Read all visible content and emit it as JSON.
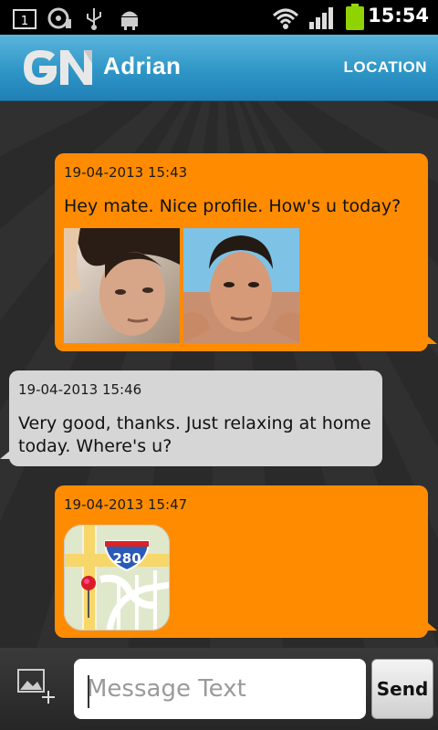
{
  "status_bar": {
    "notification_count": "1",
    "time": "15:54",
    "icons": [
      "notification-counter-icon",
      "sd-card-icon",
      "usb-icon",
      "android-debug-icon",
      "wifi-icon",
      "signal-icon",
      "battery-icon"
    ],
    "battery_color": "#8fd400"
  },
  "header": {
    "logo_text": "GN",
    "contact_name": "Adrian",
    "location_label": "LOCATION",
    "color": "#3aa3d2"
  },
  "messages": [
    {
      "direction": "outgoing",
      "timestamp": "19-04-2013 15:43",
      "text": "Hey mate. Nice profile. How's u today?",
      "attachments": [
        "photo-1",
        "photo-2"
      ]
    },
    {
      "direction": "incoming",
      "timestamp": "19-04-2013 15:46",
      "text_line1": "Very good, thanks. Just relaxing at home",
      "text_line2": "today. Where's u?"
    },
    {
      "direction": "outgoing",
      "timestamp": "19-04-2013 15:47",
      "attachments": [
        "map-location"
      ],
      "map_shield": "280"
    }
  ],
  "colors": {
    "outgoing_bubble": "#ff8c00",
    "incoming_bubble": "#d6d6d6"
  },
  "composer": {
    "placeholder": "Message Text",
    "value": "",
    "send_label": "Send"
  }
}
